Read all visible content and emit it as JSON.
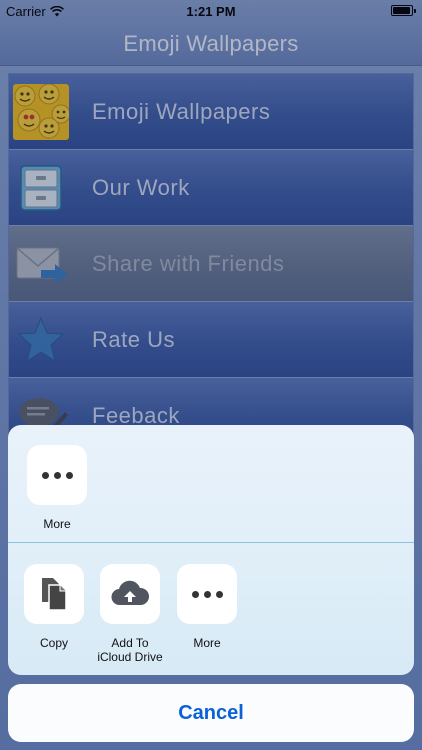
{
  "status_bar": {
    "carrier": "Carrier",
    "time": "1:21 PM",
    "battery_level": 0.95
  },
  "nav": {
    "title": "Emoji Wallpapers"
  },
  "menu": {
    "items": [
      {
        "label": "Emoji Wallpapers",
        "icon": "emoji-faces-icon"
      },
      {
        "label": "Our Work",
        "icon": "drawer-cabinet-icon"
      },
      {
        "label": "Share with Friends",
        "icon": "envelope-arrow-icon"
      },
      {
        "label": "Rate Us",
        "icon": "star-icon"
      },
      {
        "label": "Feeback",
        "icon": "speech-bubble-pencil-icon"
      }
    ]
  },
  "share_sheet": {
    "top_row": [
      {
        "label": "More",
        "icon": "more-dots-icon"
      }
    ],
    "bottom_row": [
      {
        "label": "Copy",
        "icon": "copy-documents-icon"
      },
      {
        "label_line1": "Add To",
        "label_line2": "iCloud Drive",
        "icon": "icloud-upload-icon"
      },
      {
        "label": "More",
        "icon": "more-dots-icon"
      }
    ],
    "cancel_label": "Cancel"
  },
  "colors": {
    "accent": "#0a62d6",
    "list_blue": "#3f5fa9",
    "sheet_bg": "#dfeef8"
  }
}
